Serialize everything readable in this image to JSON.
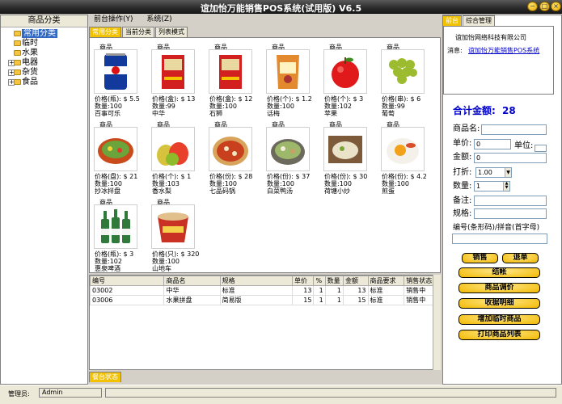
{
  "window": {
    "title": "谊加怡万能销售POS系统(试用版)   V6.5"
  },
  "category_panel": {
    "header": "商品分类",
    "nodes": [
      {
        "label": "常用分类",
        "expander": ""
      },
      {
        "label": "临时",
        "expander": ""
      },
      {
        "label": "水果",
        "expander": ""
      },
      {
        "label": "电器",
        "expander": "+"
      },
      {
        "label": "杂货",
        "expander": "+"
      },
      {
        "label": "食品",
        "expander": "+"
      }
    ]
  },
  "menu": {
    "items": [
      "前台操作(Y)",
      "系统(Z)"
    ]
  },
  "view_tabs": [
    "常用分类",
    "当前分类",
    "列表模式"
  ],
  "products": [
    {
      "kind": "商品",
      "price": "价格(瓶): $ 5.5",
      "qty": "数量:100",
      "name": "百事可乐",
      "icon": "cola-can"
    },
    {
      "kind": "商品",
      "price": "价格(盒): $ 13",
      "qty": "数量:99",
      "name": "中华",
      "icon": "cigarette-pack"
    },
    {
      "kind": "商品",
      "price": "价格(盒): $ 12",
      "qty": "数量:100",
      "name": "石狮",
      "icon": "cigarette-pack"
    },
    {
      "kind": "商品",
      "price": "价格(个): $ 1.2",
      "qty": "数量:100",
      "name": "话梅",
      "icon": "snack-bag"
    },
    {
      "kind": "商品",
      "price": "价格(个): $ 3",
      "qty": "数量:102",
      "name": "苹果",
      "icon": "apple"
    },
    {
      "kind": "商品",
      "price": "价格(串): $ 6",
      "qty": "数量:99",
      "name": "葡萄",
      "icon": "grapes"
    },
    {
      "kind": "商品",
      "price": "价格(盘): $ 21",
      "qty": "数量:100",
      "name": "抄冰拌盘",
      "icon": "salad-bowl"
    },
    {
      "kind": "商品",
      "price": "价格(个): $ 1",
      "qty": "数量:103",
      "name": "香水梨",
      "icon": "pears"
    },
    {
      "kind": "商品",
      "price": "价格(份): $ 28",
      "qty": "数量:100",
      "name": "七品码锅",
      "icon": "hot-dish"
    },
    {
      "kind": "商品",
      "price": "价格(份): $ 37",
      "qty": "数量:100",
      "name": "白菜鸭汤",
      "icon": "soup-pot"
    },
    {
      "kind": "商品",
      "price": "价格(份): $ 30",
      "qty": "数量:100",
      "name": "荷塘小炒",
      "icon": "stir-fry"
    },
    {
      "kind": "商品",
      "price": "价格(份): $ 4.2",
      "qty": "数量:100",
      "name": "煎蛋",
      "icon": "fried-egg"
    },
    {
      "kind": "商品",
      "price": "价格(瓶): $ 3",
      "qty": "数量:102",
      "name": "惠泉啤酒",
      "icon": "beer-bottles"
    },
    {
      "kind": "商品",
      "price": "价格(只): $ 320",
      "qty": "数量:100",
      "name": "山地车",
      "icon": "noodle-cup"
    }
  ],
  "sales_grid": {
    "headers": [
      "编号",
      "商品名",
      "规格",
      "单价",
      "%",
      "数量",
      "金额",
      "商品要求",
      "销售状态"
    ],
    "rows": [
      [
        "03002",
        "中华",
        "标准",
        "13",
        "1",
        "1",
        "13",
        "标准",
        "销售中"
      ],
      [
        "03006",
        "水果拼盘",
        "简易版",
        "15",
        "1",
        "1",
        "15",
        "标准",
        "销售中"
      ]
    ]
  },
  "bottom_tab": "餐台状态",
  "right_tabs": [
    "前台",
    "综合管理"
  ],
  "company": "谊加怡网络科技有限公司",
  "message": {
    "label": "消息:",
    "text": "谊加怡万能销售POS系统"
  },
  "form": {
    "total_label": "合计金额:",
    "total_value": "28",
    "name_label": "商品名:",
    "price_label": "单价:",
    "price_value": "0",
    "unit_label": "单位:",
    "amount_label": "金额:",
    "amount_value": "0",
    "discount_label": "打折:",
    "discount_value": "1.00",
    "qty_label": "数量:",
    "qty_value": "1",
    "note_label": "备注:",
    "spec_label": "规格:",
    "code_label": "编号(条形码)/拼音(首字母)"
  },
  "buttons": {
    "sale": "销售",
    "return": "退单",
    "checkout": "结帐",
    "price_adjust": "商品调价",
    "receipt_detail": "收据明细",
    "add_temp": "增加临时商品",
    "print_list": "打印商品列表"
  },
  "status": {
    "admin_label": "管理员:",
    "admin_value": "Admin"
  },
  "colors": {
    "accent": "#f2c200",
    "selected": "#316ac5",
    "total": "#0000cc"
  }
}
